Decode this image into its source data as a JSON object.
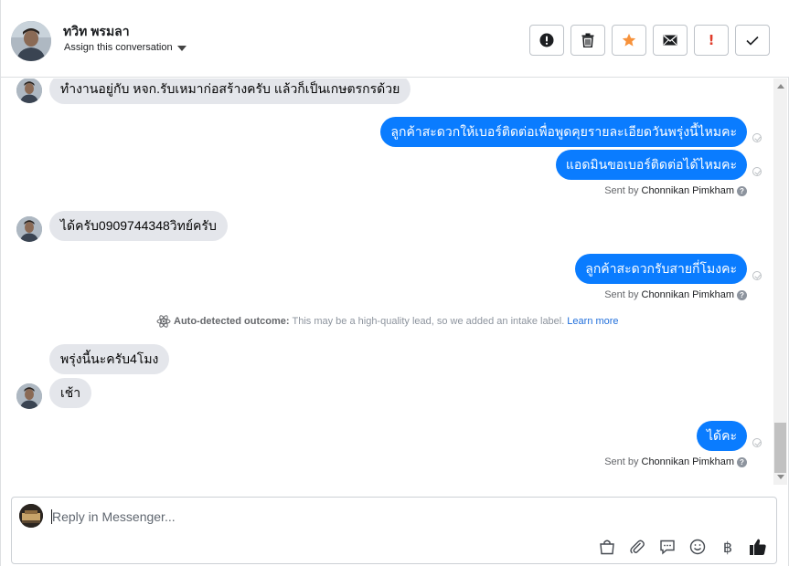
{
  "header": {
    "contact_name": "ทวิท พรมลา",
    "assign_label": "Assign this conversation",
    "actions": [
      {
        "name": "mark-spam-button",
        "icon": "alert-circle-icon"
      },
      {
        "name": "delete-button",
        "icon": "trash-icon"
      },
      {
        "name": "star-button",
        "icon": "star-icon"
      },
      {
        "name": "mark-unread-button",
        "icon": "envelope-icon"
      },
      {
        "name": "follow-up-button",
        "icon": "exclamation-icon"
      },
      {
        "name": "mark-done-button",
        "icon": "checkmark-icon"
      }
    ],
    "follow_up_glyph": "!"
  },
  "messages": [
    {
      "direction": "in",
      "text": "ทำงานอยู่กับ หจก.รับเหมาก่อสร้างครับ แล้วก็เป็นเกษตรกรด้วย"
    },
    {
      "direction": "out",
      "text": "ลูกค้าสะดวกให้เบอร์ติดต่อเพื่อพูดคุยรายละเอียดวันพรุ่งนี้ไหมคะ"
    },
    {
      "direction": "out",
      "text": "แอดมินขอเบอร์ติดต่อได้ไหมคะ"
    },
    {
      "direction": "in",
      "text": "ได้ครับ0909744348วิทย์ครับ"
    },
    {
      "direction": "out",
      "text": "ลูกค้าสะดวกรับสายกี่โมงคะ"
    },
    {
      "direction": "in",
      "text": "พรุ่งนี้นะครับ4โมง"
    },
    {
      "direction": "in",
      "text": "เช้า"
    },
    {
      "direction": "out",
      "text": "ได้คะ"
    }
  ],
  "sent_by": {
    "prefix": "Sent by",
    "name": "Chonnikan Pimkham",
    "help_glyph": "?"
  },
  "outcome": {
    "icon": "atom-icon",
    "label": "Auto-detected outcome:",
    "text": "This may be a high-quality lead, so we added an intake label.",
    "link": "Learn more"
  },
  "composer": {
    "placeholder": "Reply in Messenger...",
    "value": "",
    "tools": [
      "shopping-bag-icon",
      "paperclip-icon",
      "saved-reply-icon",
      "emoji-icon",
      "baht-icon",
      "thumbs-up-icon"
    ],
    "baht_glyph": "฿"
  },
  "colors": {
    "outgoing_bubble": "#0a7cff",
    "incoming_bubble": "#e4e6eb",
    "star": "#f7923b",
    "follow_up": "#e03c2b",
    "link": "#216fdb"
  }
}
